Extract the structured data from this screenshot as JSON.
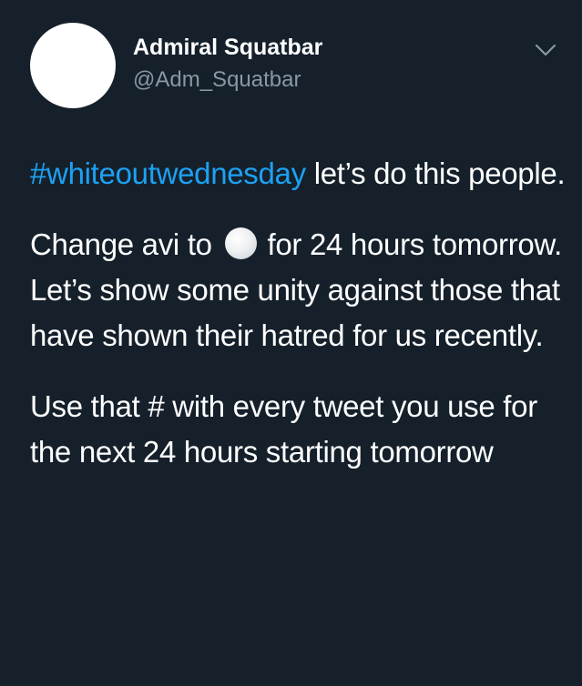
{
  "author": {
    "display_name": "Admiral Squatbar",
    "handle": "@Adm_Squatbar",
    "avatar_icon": "white-circle-avatar",
    "avatar_color": "#ffffff"
  },
  "menu": {
    "icon": "chevron-down-icon"
  },
  "tweet": {
    "hashtag": "#whiteoutwednesday",
    "line1_rest": " let’s do this people.",
    "p2_before_emoji": "Change avi to ",
    "emoji_icon": "white-circle-emoji",
    "p2_after_emoji": " for 24 hours tomorrow. Let’s show some unity against those that have shown their hatred for us recently.",
    "p3": "Use that # with every tweet you use for the next 24 hours starting tomorrow"
  },
  "colors": {
    "background": "#15202b",
    "text": "#ffffff",
    "secondary_text": "#8899a6",
    "link": "#1da1f2"
  }
}
